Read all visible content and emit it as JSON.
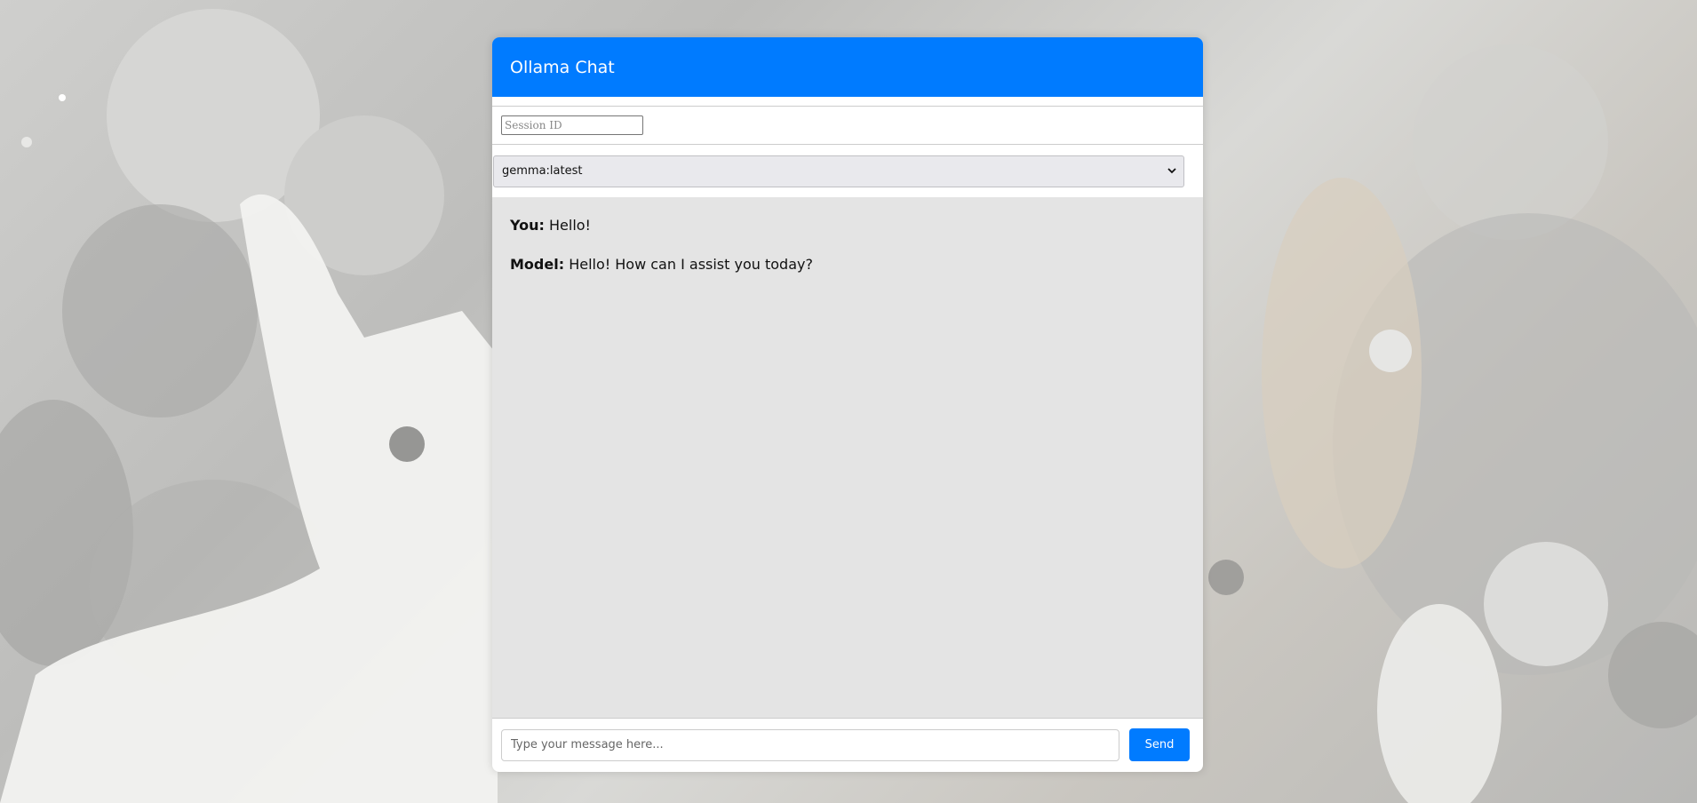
{
  "app": {
    "title": "Ollama Chat"
  },
  "session": {
    "placeholder": "Session ID",
    "value": ""
  },
  "model_select": {
    "selected": "gemma:latest"
  },
  "messages": [
    {
      "sender": "You:",
      "text": "Hello!"
    },
    {
      "sender": "Model:",
      "text": "Hello! How can I assist you today?"
    }
  ],
  "composer": {
    "placeholder": "Type your message here...",
    "send_label": "Send"
  },
  "colors": {
    "accent": "#007bff",
    "chat_background": "#e4e4e4"
  },
  "icons": {
    "select_arrow": "chevron-down-icon"
  }
}
